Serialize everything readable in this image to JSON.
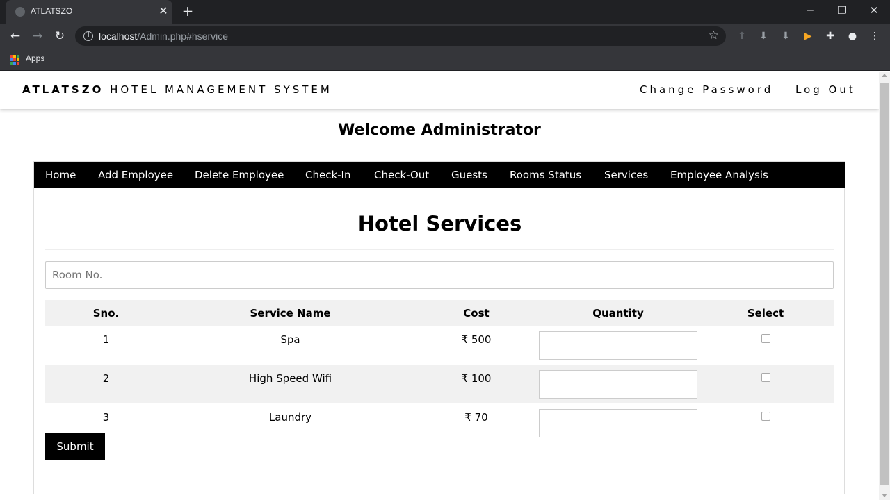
{
  "browser": {
    "tab_title": "ATLATSZO",
    "url_host": "localhost",
    "url_path": "/Admin.php#hservice",
    "bookmarks_apps_label": "Apps"
  },
  "header": {
    "brand_bold": "ATLATSZO",
    "brand_rest": " HOTEL MANAGEMENT SYSTEM",
    "change_password": "Change Password",
    "logout": "Log Out"
  },
  "welcome": "Welcome Administrator",
  "nav": {
    "items": [
      "Home",
      "Add Employee",
      "Delete Employee",
      "Check-In",
      "Check-Out",
      "Guests",
      "Rooms Status",
      "Services",
      "Employee Analysis"
    ]
  },
  "services": {
    "title": "Hotel Services",
    "room_placeholder": "Room No.",
    "columns": [
      "Sno.",
      "Service Name",
      "Cost",
      "Quantity",
      "Select"
    ],
    "rows": [
      {
        "sno": "1",
        "name": "Spa",
        "cost": "₹ 500",
        "checked": false
      },
      {
        "sno": "2",
        "name": "High Speed Wifi",
        "cost": "₹ 100",
        "checked": false
      },
      {
        "sno": "3",
        "name": "Laundry",
        "cost": "₹ 70",
        "checked": false
      }
    ],
    "submit_label": "Submit"
  },
  "colors": {
    "navbar_bg": "#000000",
    "row_alt_bg": "#f1f1f1",
    "submit_bg": "#000000"
  }
}
